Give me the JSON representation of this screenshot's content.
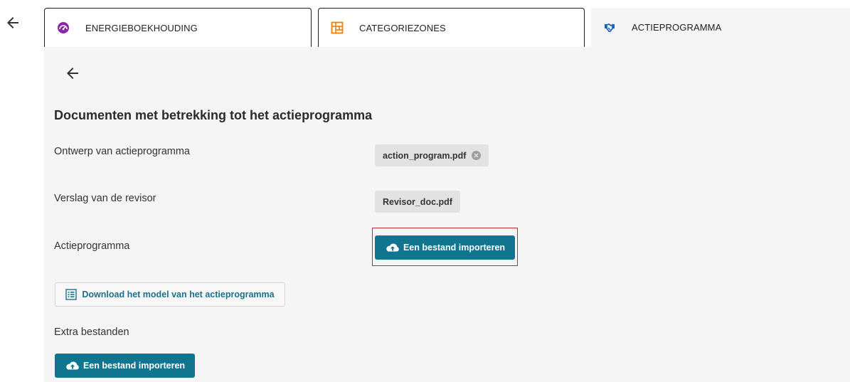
{
  "tabs": [
    {
      "label": "ENERGIEBOEKHOUDING",
      "icon": "gauge-icon",
      "icon_color": "#8e24aa"
    },
    {
      "label": "CATEGORIEZONES",
      "icon": "map-icon",
      "icon_color": "#f57c00"
    },
    {
      "label": "ACTIEPROGRAMMA",
      "icon": "handshake-icon",
      "icon_color": "#1565c0",
      "active": true
    }
  ],
  "panel": {
    "title": "Documenten met betrekking tot het actieprogramma",
    "rows": [
      {
        "label": "Ontwerp van actieprogramma",
        "file": "action_program.pdf",
        "removable": true
      },
      {
        "label": "Verslag van de revisor",
        "file": "Revisor_doc.pdf",
        "removable": false
      },
      {
        "label": "Actieprogramma",
        "button": "Een bestand importeren"
      }
    ],
    "download_button": "Download het model van het actieprogramma",
    "extra_label": "Extra bestanden",
    "extra_button": "Een bestand importeren"
  },
  "colors": {
    "primary": "#11758f",
    "highlight": "#c62828",
    "panel_bg": "#f5f5f5",
    "chip_bg": "#e2e2e2"
  }
}
